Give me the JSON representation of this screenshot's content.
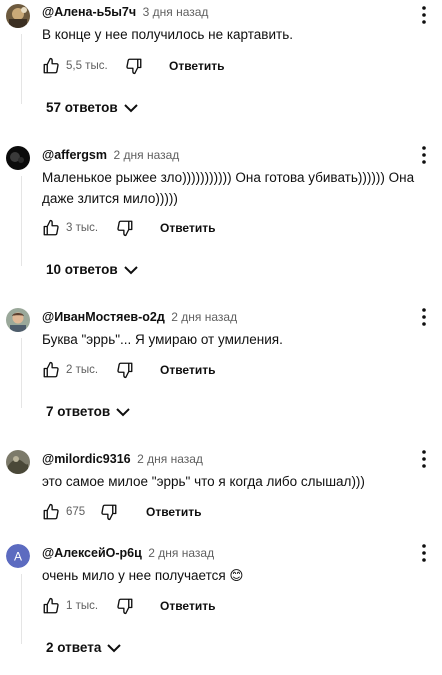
{
  "comments": [
    {
      "author": "@Алена-ь5ы7ч",
      "time": "3 дня назад",
      "text": "В конце у нее получилось не картавить.",
      "likes": "5,5 тыс.",
      "reply_label": "Ответить",
      "replies_label": "57 ответов",
      "avatar_icon": "user-photo-avatar"
    },
    {
      "author": "@affergsm",
      "time": "2 дня назад",
      "text": "Маленькое рыжее зло))))))))))) Она готова убивать)))))) Она даже злится мило)))))",
      "likes": "3 тыс.",
      "reply_label": "Ответить",
      "replies_label": "10 ответов",
      "avatar_icon": "user-photo-avatar"
    },
    {
      "author": "@ИванМостяев-о2д",
      "time": "2 дня назад",
      "text": "Буква \"эррь\"... Я умираю от умиления.",
      "likes": "2 тыс.",
      "reply_label": "Ответить",
      "replies_label": "7 ответов",
      "avatar_icon": "user-photo-avatar"
    },
    {
      "author": "@milordic9316",
      "time": "2 дня назад",
      "text": "это самое милое \"эррь\" что я когда либо слышал)))",
      "likes": "675",
      "reply_label": "Ответить",
      "avatar_icon": "user-photo-avatar"
    },
    {
      "author": "@АлексейО-р6ц",
      "time": "2 дня назад",
      "text": "очень мило у нее получается 😊",
      "likes": "1 тыс.",
      "reply_label": "Ответить",
      "replies_label": "2 ответа",
      "avatar_letter": "А",
      "avatar_color": "#5c6bc0"
    }
  ],
  "colors": {
    "text_primary": "#0f0f0f",
    "text_secondary": "#606060",
    "thread_line": "#e5e5e5"
  }
}
